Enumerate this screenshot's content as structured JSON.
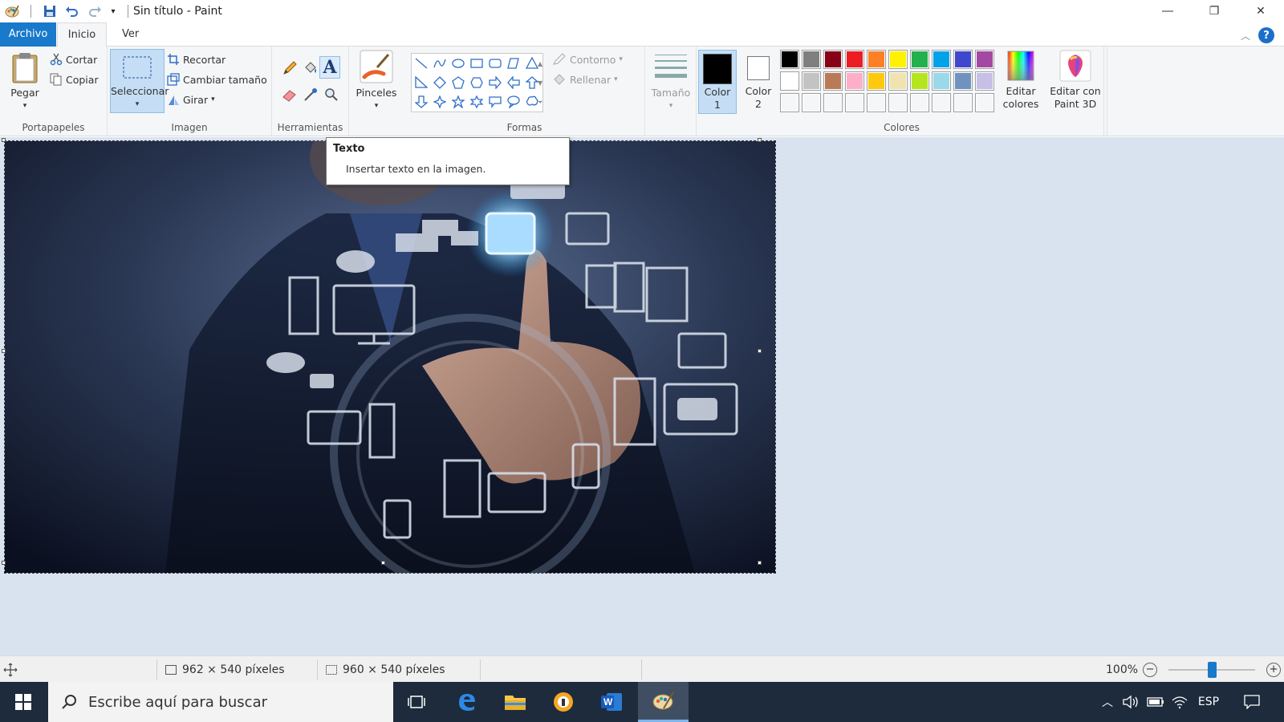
{
  "window": {
    "title": "Sin título - Paint"
  },
  "tabs": {
    "file": "Archivo",
    "home": "Inicio",
    "view": "Ver"
  },
  "clipboard": {
    "paste": "Pegar",
    "cut": "Cortar",
    "copy": "Copiar",
    "label": "Portapapeles"
  },
  "image": {
    "select": "Seleccionar",
    "crop": "Recortar",
    "resize": "Cambiar tamaño",
    "rotate": "Girar",
    "label": "Imagen"
  },
  "tools": {
    "label": "Herramientas"
  },
  "brushes": {
    "label": "Pinceles"
  },
  "shapes": {
    "label": "Formas",
    "outline": "Contorno",
    "fill": "Rellenar"
  },
  "size": {
    "label": "Tamaño"
  },
  "colors": {
    "label": "Colores",
    "color1_line1": "Color",
    "color1_line2": "1",
    "color2_line1": "Color",
    "color2_line2": "2",
    "color1": "#000000",
    "color2": "#ffffff",
    "edit_line1": "Editar",
    "edit_line2": "colores",
    "paint3d_line1": "Editar con",
    "paint3d_line2": "Paint 3D",
    "palette": [
      "#000000",
      "#7f7f7f",
      "#880015",
      "#ed1c24",
      "#ff7f27",
      "#fff200",
      "#22b14c",
      "#00a2e8",
      "#3f48cc",
      "#a349a4",
      "#ffffff",
      "#c3c3c3",
      "#b97a57",
      "#ffaec9",
      "#ffc90e",
      "#efe4b0",
      "#b5e61d",
      "#99d9ea",
      "#7092be",
      "#c8bfe7",
      "#f5f6f7",
      "#f5f6f7",
      "#f5f6f7",
      "#f5f6f7",
      "#f5f6f7",
      "#f5f6f7",
      "#f5f6f7",
      "#f5f6f7",
      "#f5f6f7",
      "#f5f6f7"
    ]
  },
  "tooltip": {
    "title": "Texto",
    "description": "Insertar texto en la imagen."
  },
  "status": {
    "canvas_size": "962 × 540 píxeles",
    "selection_size": "960 × 540 píxeles",
    "zoom": "100%"
  },
  "taskbar": {
    "search_placeholder": "Escribe aquí para buscar",
    "language": "ESP"
  }
}
